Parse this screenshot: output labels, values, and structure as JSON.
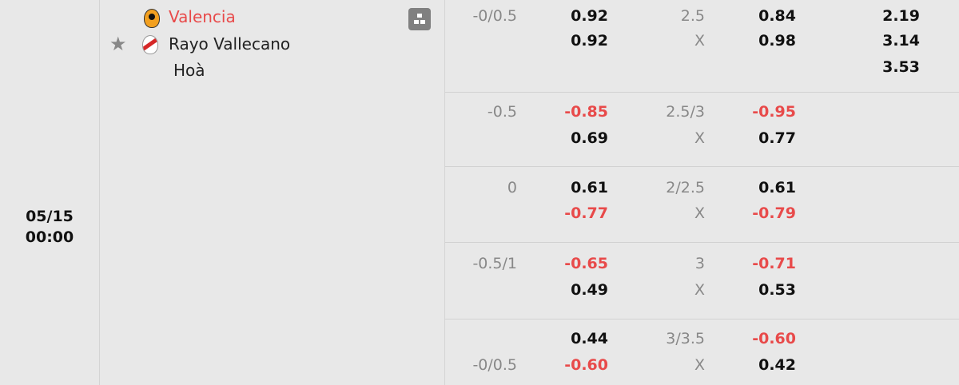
{
  "match": {
    "date": "05/15",
    "time": "00:00",
    "home_team": "Valencia",
    "away_team": "Rayo Vallecano",
    "draw_label": "Hoà",
    "home_color": "#e84a4a"
  },
  "odds_rows": [
    {
      "hcap_top": "-0/0.5",
      "hcap_bottom": "",
      "ah_home": "0.92",
      "ah_away": "0.92",
      "ou_line": "2.5",
      "ou_x": "X",
      "ou_over": "0.84",
      "ou_under": "0.98",
      "x12_home": "2.19",
      "x12_away": "3.14",
      "x12_draw": "3.53"
    },
    {
      "hcap_top": "-0.5",
      "hcap_bottom": "",
      "ah_home": "-0.85",
      "ah_away": "0.69",
      "ou_line": "2.5/3",
      "ou_x": "X",
      "ou_over": "-0.95",
      "ou_under": "0.77"
    },
    {
      "hcap_top": "0",
      "hcap_bottom": "",
      "ah_home": "0.61",
      "ah_away": "-0.77",
      "ou_line": "2/2.5",
      "ou_x": "X",
      "ou_over": "0.61",
      "ou_under": "-0.79"
    },
    {
      "hcap_top": "-0.5/1",
      "hcap_bottom": "",
      "ah_home": "-0.65",
      "ah_away": "0.49",
      "ou_line": "3",
      "ou_x": "X",
      "ou_over": "-0.71",
      "ou_under": "0.53"
    },
    {
      "hcap_top": "",
      "hcap_bottom": "-0/0.5",
      "ah_home": "0.44",
      "ah_away": "-0.60",
      "ou_line": "3/3.5",
      "ou_x": "X",
      "ou_over": "-0.60",
      "ou_under": "0.42"
    }
  ],
  "icons": {
    "favorite": "star-icon",
    "stats": "stats-icon",
    "home_logo": "valencia-logo-icon",
    "away_logo": "rayo-vallecano-logo-icon"
  }
}
